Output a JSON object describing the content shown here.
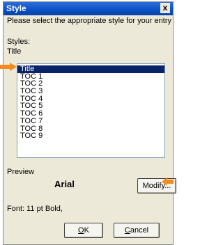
{
  "window": {
    "title": "Style",
    "close_label": "x"
  },
  "instructions": "Please select the appropriate style for your entry",
  "styles_label": "Styles:",
  "current_style": "Title",
  "styles_list": [
    "Title",
    "TOC 1",
    "TOC 2",
    "TOC 3",
    "TOC 4",
    "TOC 5",
    "TOC 6",
    "TOC 7",
    "TOC 8",
    "TOC 9"
  ],
  "selected_index": 0,
  "preview": {
    "label": "Preview",
    "font_name": "Arial"
  },
  "modify_button": "Modify...",
  "font_description": "Font: 11 pt Bold,",
  "ok_button": {
    "prefix": "",
    "accel": "O",
    "suffix": "K"
  },
  "cancel_button": {
    "prefix": "",
    "accel": "C",
    "suffix": "ancel"
  },
  "colors": {
    "titlebar": "#0a4fc4",
    "selection": "#0a246a",
    "arrow": "#f28c1e",
    "dialog_bg": "#ece9d8"
  }
}
